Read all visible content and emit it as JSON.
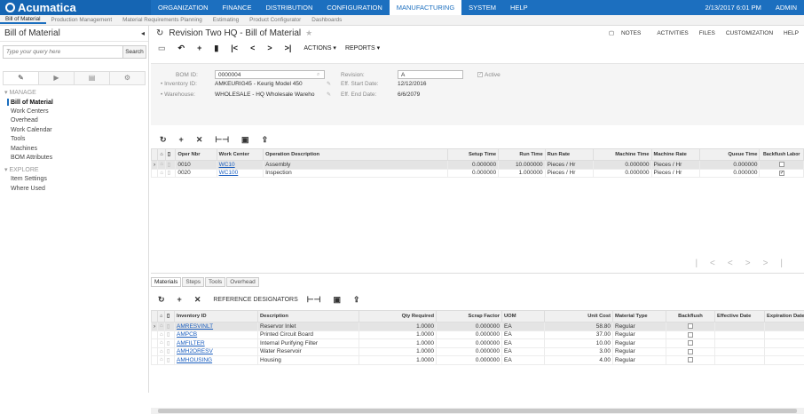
{
  "topbar": {
    "brand": "Acumatica",
    "modules": [
      "ORGANIZATION",
      "FINANCE",
      "DISTRIBUTION",
      "CONFIGURATION",
      "MANUFACTURING",
      "SYSTEM",
      "HELP"
    ],
    "datetime": "2/13/2017 6:01 PM",
    "user": "ADMIN"
  },
  "subbar": [
    "Bill of Material",
    "Production Management",
    "Material Requirements Planning",
    "Estimating",
    "Product Configurator",
    "Dashboards"
  ],
  "sidebar": {
    "title": "Bill of Material",
    "search_placeholder": "Type your query here",
    "search_label": "Search",
    "manage_label": "MANAGE",
    "manage_items": [
      "Bill of Material",
      "Work Centers",
      "Overhead",
      "Work Calendar",
      "Tools",
      "Machines",
      "BOM Attributes"
    ],
    "explore_label": "EXPLORE",
    "explore_items": [
      "Item Settings",
      "Where Used"
    ]
  },
  "header": {
    "title": "Revision Two HQ - Bill of Material",
    "links": [
      "NOTES",
      "ACTIVITIES",
      "FILES",
      "CUSTOMIZATION",
      "HELP"
    ]
  },
  "toolbar": {
    "actions": "ACTIONS ▾",
    "reports": "REPORTS ▾"
  },
  "form": {
    "bom_id_label": "BOM ID:",
    "bom_id": "0000004",
    "inventory_label": "• Inventory ID:",
    "inventory": "AMKEURIG45 - Keurig Model 450",
    "warehouse_label": "• Warehouse:",
    "warehouse": "WHOLESALE - HQ Wholesale Wareho",
    "revision_label": "Revision:",
    "revision": "A",
    "start_label": "Eff. Start Date:",
    "start": "12/12/2016",
    "end_label": "Eff. End Date:",
    "end": "6/6/2079",
    "active_label": "Active"
  },
  "operations": {
    "headers": [
      "Oper Nbr",
      "Work Center",
      "Operation Description",
      "Setup Time",
      "Run Time",
      "Run Rate",
      "Machine Time",
      "Machine Rate",
      "Queue Time",
      "Backflush Labor"
    ],
    "rows": [
      {
        "oper": "0010",
        "wc": "WC10",
        "desc": "Assembly",
        "setup": "0.000000",
        "run": "10.000000",
        "rate": "Pieces / Hr",
        "mtime": "0.000000",
        "mrate": "Pieces / Hr",
        "queue": "0.000000",
        "backflush": false
      },
      {
        "oper": "0020",
        "wc": "WC100",
        "desc": "Inspection",
        "setup": "0.000000",
        "run": "1.000000",
        "rate": "Pieces / Hr",
        "mtime": "0.000000",
        "mrate": "Pieces / Hr",
        "queue": "0.000000",
        "backflush": true
      }
    ]
  },
  "tabs": [
    "Materials",
    "Steps",
    "Tools",
    "Overhead"
  ],
  "materials_toolbar": {
    "ref": "REFERENCE DESIGNATORS"
  },
  "materials": {
    "headers": [
      "Inventory ID",
      "Description",
      "Qty Required",
      "Scrap Factor",
      "UOM",
      "Unit Cost",
      "Material Type",
      "Backflush",
      "Effective Date",
      "Expiration Date"
    ],
    "rows": [
      {
        "id": "AMRESVINLT",
        "desc": "Reservor Inlet",
        "qty": "1.0000",
        "scrap": "0.000000",
        "uom": "EA",
        "cost": "58.80",
        "type": "Regular"
      },
      {
        "id": "AMPCB",
        "desc": "Printed Circuit Board",
        "qty": "1.0000",
        "scrap": "0.000000",
        "uom": "EA",
        "cost": "37.00",
        "type": "Regular"
      },
      {
        "id": "AMFILTER",
        "desc": "Internal Purifying Filter",
        "qty": "1.0000",
        "scrap": "0.000000",
        "uom": "EA",
        "cost": "10.00",
        "type": "Regular"
      },
      {
        "id": "AMH2ORESV",
        "desc": "Water Reservoir",
        "qty": "1.0000",
        "scrap": "0.000000",
        "uom": "EA",
        "cost": "3.00",
        "type": "Regular"
      },
      {
        "id": "AMHOUSING",
        "desc": "Housing",
        "qty": "1.0000",
        "scrap": "0.000000",
        "uom": "EA",
        "cost": "4.00",
        "type": "Regular"
      }
    ]
  }
}
